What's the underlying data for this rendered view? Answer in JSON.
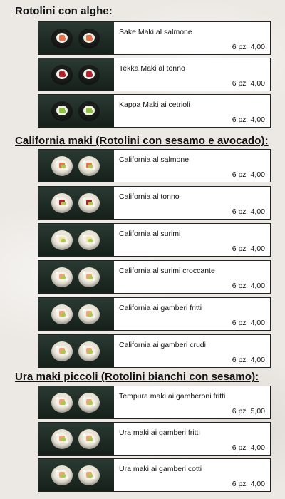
{
  "colors": {
    "salmon": "#e8734a",
    "tuna": "#b5202f",
    "cucumber": "#8ec23e",
    "avocado": "#a9c94a",
    "shrimp": "#f0a47a",
    "surimi": "#f3e2a0"
  },
  "sections": [
    {
      "title": "Rotolini con alghe:",
      "items": [
        {
          "name": "Sake Maki al salmone",
          "qty": "6 pz",
          "price": "4,00",
          "fill": "salmon",
          "style": "nori"
        },
        {
          "name": "Tekka Maki al tonno",
          "qty": "6 pz",
          "price": "4,00",
          "fill": "tuna",
          "style": "nori"
        },
        {
          "name": "Kappa Maki ai cetrioli",
          "qty": "6 pz",
          "price": "4,00",
          "fill": "cucumber",
          "style": "nori"
        }
      ]
    },
    {
      "title": "California maki (Rotolini con sesamo e avocado):",
      "items": [
        {
          "name": "California al salmone",
          "qty": "6 pz",
          "price": "4,00",
          "fill": "salmon",
          "style": "rice"
        },
        {
          "name": "California al tonno",
          "qty": "6 pz",
          "price": "4,00",
          "fill": "tuna",
          "style": "rice"
        },
        {
          "name": "California al surimi",
          "qty": "6 pz",
          "price": "4,00",
          "fill": "surimi",
          "style": "rice"
        },
        {
          "name": "California al surimi croccante",
          "qty": "6 pz",
          "price": "4,00",
          "fill": "shrimp",
          "style": "rice"
        },
        {
          "name": "California ai gamberi fritti",
          "qty": "6 pz",
          "price": "4,00",
          "fill": "shrimp",
          "style": "rice"
        },
        {
          "name": "California ai gamberi crudi",
          "qty": "6 pz",
          "price": "4,00",
          "fill": "shrimp",
          "style": "rice"
        }
      ]
    },
    {
      "title": "Ura maki piccoli (Rotolini bianchi con sesamo):",
      "items": [
        {
          "name": "Tempura maki ai gamberoni fritti",
          "qty": "6 pz",
          "price": "5,00",
          "fill": "shrimp",
          "style": "rice"
        },
        {
          "name": "Ura maki ai gamberi fritti",
          "qty": "6 pz",
          "price": "4,00",
          "fill": "shrimp",
          "style": "rice"
        },
        {
          "name": "Ura maki ai gamberi cotti",
          "qty": "6 pz",
          "price": "4,00",
          "fill": "shrimp",
          "style": "rice"
        }
      ]
    }
  ]
}
